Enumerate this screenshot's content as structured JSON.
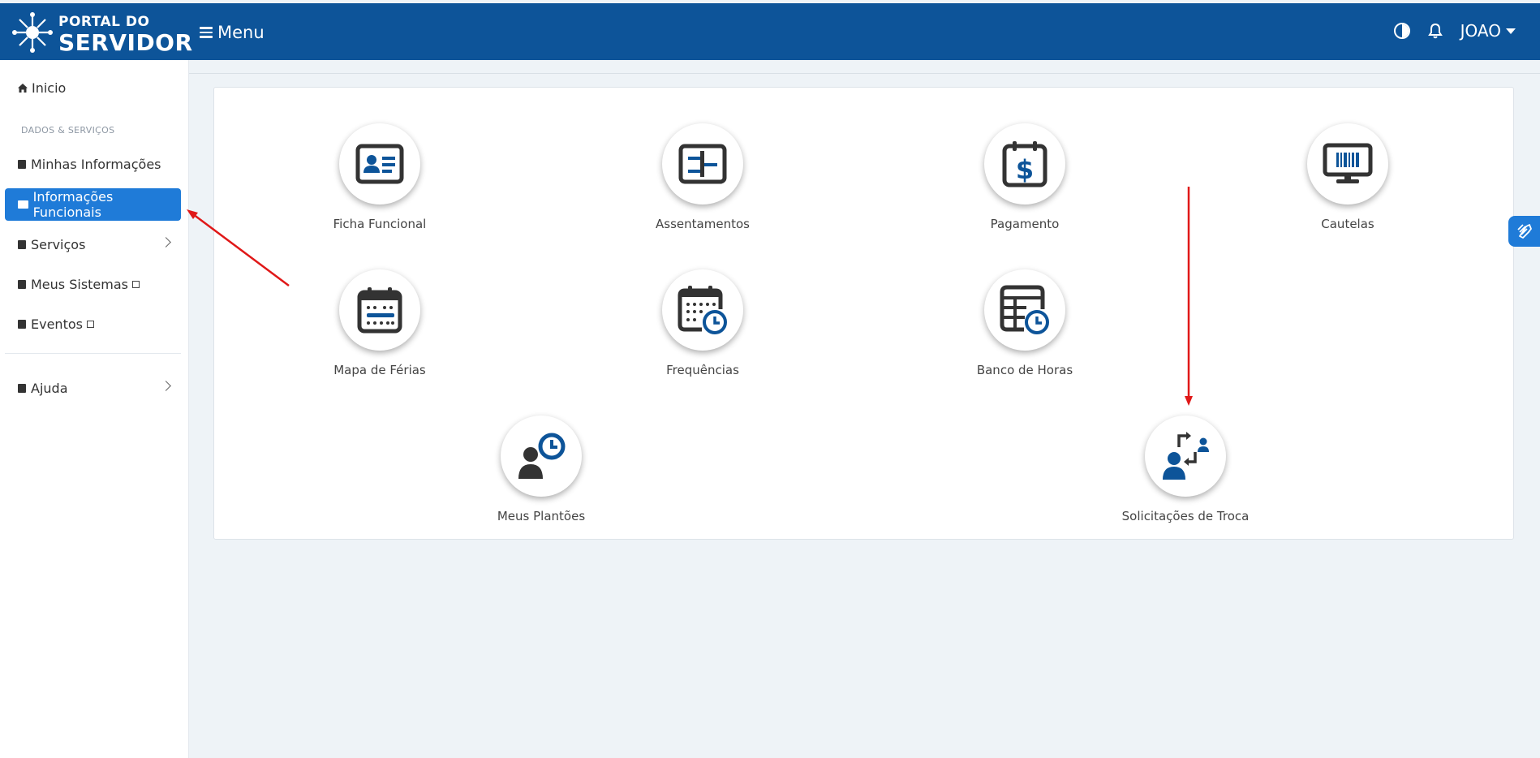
{
  "header": {
    "logo_line1": "PORTAL DO",
    "logo_line2": "SERVIDOR",
    "menu_label": "Menu",
    "user_name": "JOAO"
  },
  "sidebar": {
    "inicio": "Inicio",
    "section_label": "DADOS & SERVIÇOS",
    "items": [
      {
        "label": "Minhas Informações"
      },
      {
        "label": "Informações Funcionais"
      },
      {
        "label": "Serviços"
      },
      {
        "label": "Meus Sistemas"
      },
      {
        "label": "Eventos"
      },
      {
        "label": "Ajuda"
      }
    ]
  },
  "tiles": [
    {
      "label": "Ficha Funcional",
      "icon": "id-card-icon"
    },
    {
      "label": "Assentamentos",
      "icon": "ledger-icon"
    },
    {
      "label": "Pagamento",
      "icon": "calendar-dollar-icon"
    },
    {
      "label": "Cautelas",
      "icon": "monitor-barcode-icon"
    },
    {
      "label": "Mapa de Férias",
      "icon": "calendar-icon"
    },
    {
      "label": "Frequências",
      "icon": "calendar-clock-icon"
    },
    {
      "label": "Banco de Horas",
      "icon": "table-clock-icon"
    },
    {
      "label": "Meus Plantões",
      "icon": "user-clock-icon"
    },
    {
      "label": "Solicitações de Troca",
      "icon": "user-swap-icon"
    }
  ],
  "colors": {
    "header_bg": "#0d5499",
    "active_item": "#1f7bd8",
    "icon_blue": "#0d5499",
    "annotation_arrow": "#e01818"
  }
}
